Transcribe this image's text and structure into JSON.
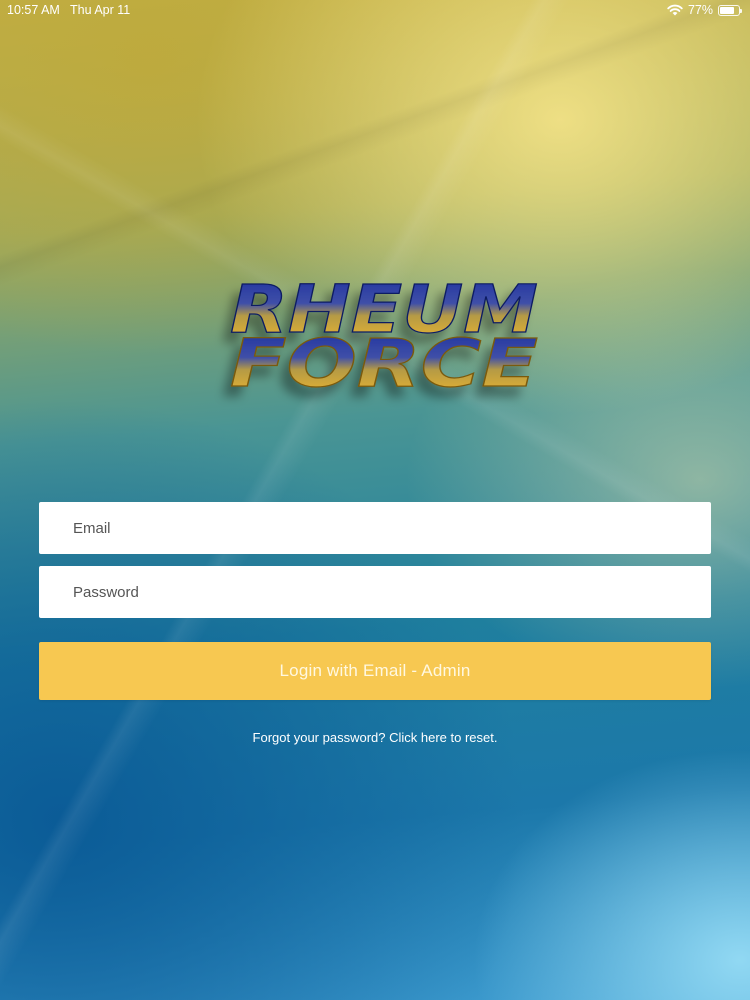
{
  "status_bar": {
    "time": "10:57 AM",
    "date": "Thu Apr 11",
    "battery_percent": "77%",
    "battery_level": 0.77,
    "wifi_icon": "wifi-icon",
    "battery_icon": "battery-icon"
  },
  "logo": {
    "line1": "RHEUM",
    "line2": "FORCE"
  },
  "login_form": {
    "email_placeholder": "Email",
    "email_value": "",
    "password_placeholder": "Password",
    "password_value": "",
    "login_button_label": "Login with Email - Admin",
    "forgot_password_text": "Forgot your password? Click here to reset."
  },
  "colors": {
    "button": "#f7c851",
    "logo_blue": "#1b2f9e",
    "logo_gold": "#f2b62d"
  }
}
